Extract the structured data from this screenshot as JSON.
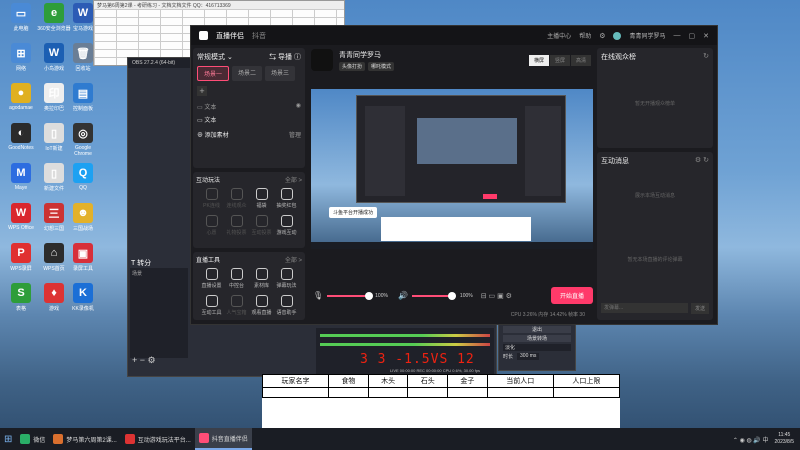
{
  "desktop": {
    "icons": [
      {
        "label": "此电脑",
        "color": "#4a8ad6",
        "glyph": "▭"
      },
      {
        "label": "360安全浏览器",
        "color": "#2e9d3a",
        "glyph": "e"
      },
      {
        "label": "宝马游戏",
        "color": "#2c5cb5",
        "glyph": "W"
      },
      {
        "label": "网络",
        "color": "#4a8ad6",
        "glyph": "⊞"
      },
      {
        "label": "小鸟游戏",
        "color": "#1c5fb3",
        "glyph": "W"
      },
      {
        "label": "回收站",
        "color": "#6a7e96",
        "glyph": "🗑"
      },
      {
        "label": "agodamae",
        "color": "#e0b020",
        "glyph": "●"
      },
      {
        "label": "奥拉印巴",
        "color": "#eeeeee",
        "glyph": "印"
      },
      {
        "label": "控制面板",
        "color": "#2f7bd0",
        "glyph": "▤"
      },
      {
        "label": "GoodNotes",
        "color": "#2b2b2b",
        "glyph": "◐"
      },
      {
        "label": "IoT新建",
        "color": "#dddddd",
        "glyph": "▯"
      },
      {
        "label": "Google Chrome",
        "color": "#333333",
        "glyph": "◎"
      },
      {
        "label": "Maye",
        "color": "#2d6de0",
        "glyph": "M"
      },
      {
        "label": "新建文件",
        "color": "#dddddd",
        "glyph": "▯"
      },
      {
        "label": "QQ",
        "color": "#1da1f2",
        "glyph": "Q"
      },
      {
        "label": "WPS Office",
        "color": "#d9272e",
        "glyph": "W"
      },
      {
        "label": "幻想三国",
        "color": "#c33",
        "glyph": "三"
      },
      {
        "label": "三国战场",
        "color": "#e3b12a",
        "glyph": "☻"
      },
      {
        "label": "WPS录屏",
        "color": "#e03030",
        "glyph": "P"
      },
      {
        "label": "WPS首页",
        "color": "#2c2c2c",
        "glyph": "⌂"
      },
      {
        "label": "录屏工具",
        "color": "#d72f3a",
        "glyph": "▣"
      },
      {
        "label": "表格",
        "color": "#2e9d3a",
        "glyph": "S"
      },
      {
        "label": "游戏",
        "color": "#d33",
        "glyph": "♦"
      },
      {
        "label": "KK录像机",
        "color": "#1b6fd6",
        "glyph": "K"
      }
    ]
  },
  "topwindow": {
    "title": "梦马第6周第2课 - 考研练习 - 文档文档文件 QQ：416713369"
  },
  "obs": {
    "title": "OBS 27.2.4 (64-bit)",
    "sources_header": "T  转分",
    "col": "场景",
    "col2": "场景",
    "big_text": "3 3 -1.5VS 12"
  },
  "live": {
    "app_title": "直播伴侣",
    "tab_label": "抖音",
    "user_name": "青青同学罗马",
    "title_links": [
      "主播中心",
      "帮助"
    ],
    "mode_label": "常规模式",
    "switch_label": "导播",
    "scenes": [
      "场景一",
      "场景二",
      "场景三"
    ],
    "sources": [
      {
        "name": "文本"
      },
      {
        "name": "文本"
      }
    ],
    "add_source": "添加素材",
    "source_action": "管理",
    "section_interact": "互动玩法",
    "more": "全部 >",
    "interact_tools": [
      {
        "label": "PK连线",
        "dim": true
      },
      {
        "label": "连线观众",
        "dim": true
      },
      {
        "label": "福袋",
        "dim": false
      },
      {
        "label": "抽奖红包",
        "dim": false
      },
      {
        "label": "心愿",
        "dim": true
      },
      {
        "label": "礼物投票",
        "dim": true
      },
      {
        "label": "互动投票",
        "dim": true
      },
      {
        "label": "游戏互动",
        "dim": false
      }
    ],
    "section_tools": "直播工具",
    "live_tools": [
      {
        "label": "直播设置",
        "dim": false
      },
      {
        "label": "中控台",
        "dim": false
      },
      {
        "label": "素材库",
        "dim": false
      },
      {
        "label": "弹幕玩法",
        "dim": false
      },
      {
        "label": "互动工具",
        "dim": false
      },
      {
        "label": "人气宝箱",
        "dim": true
      },
      {
        "label": "观看直播",
        "dim": false
      },
      {
        "label": "语音助手",
        "dim": false
      }
    ],
    "channel": {
      "name": "青青同学罗马",
      "tags": [
        "头像打扮",
        "哪吒模式"
      ]
    },
    "view_tabs": [
      "横屏",
      "竖屏",
      "高清"
    ],
    "preview_notice": "斗鱼平台开播成功",
    "mic_volume": "100%",
    "speaker_volume": "100%",
    "mic_level": 0.95,
    "speaker_level": 0.9,
    "start_button": "开始直播",
    "stats": "CPU 3.26%   内存 14.42%   帧率 30",
    "right_panels": {
      "audience_title": "在线观众榜",
      "audience_empty": "暂无开播观众榜单",
      "messages_title": "互动消息",
      "messages_empty": "展示本场互动消息",
      "messages_empty2": "暂无本场直播的评论弹幕",
      "chat_placeholder": "发弹幕...",
      "send_label": "发送"
    }
  },
  "excel": {
    "headers": [
      "玩家名字",
      "食物",
      "木头",
      "石头",
      "金子",
      "当前人口",
      "人口上限"
    ]
  },
  "obs_controls": {
    "rows": [
      "退出",
      "场景转场",
      "淡化",
      "时长",
      "300 ms"
    ],
    "timer": "LIVE 00:00:00    REC 00:00:00    CPU 0.6%, 30.00 fps"
  },
  "taskbar": {
    "start": "⊞",
    "items": [
      {
        "label": "微信",
        "active": false,
        "color": "#2aae67"
      },
      {
        "label": "梦马第六周第2课...",
        "active": false,
        "color": "#d96f2e"
      },
      {
        "label": "互动游戏玩法平台...",
        "active": false,
        "color": "#d33"
      },
      {
        "label": "抖音直播伴侣",
        "active": true,
        "color": "#ff4d77"
      }
    ],
    "time": "11:45",
    "date": "2023/8/5"
  }
}
